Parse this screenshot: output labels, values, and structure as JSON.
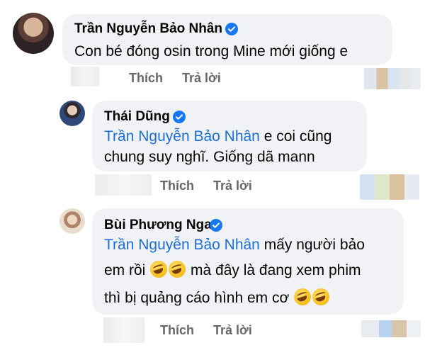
{
  "comments": [
    {
      "author": "Trần Nguyễn Bảo Nhân",
      "lines": [
        "Con bé đóng osin trong Mine mới giống e"
      ],
      "like_label": "Thích",
      "reply_label": "Trả lời",
      "avatar_colors": [
        "#3a2a2a",
        "#c9a089"
      ]
    },
    {
      "author": "Thái Dũng",
      "mention": "Trần Nguyễn Bảo Nhân",
      "line1_rest": " e coi cũng",
      "line2": "chung suy nghĩ. Giống dã mann",
      "like_label": "Thích",
      "reply_label": "Trả lời",
      "avatar_colors": [
        "#2b3a5a",
        "#d8c3b0"
      ]
    },
    {
      "author": "Bùi Phương Nga",
      "mention": "Trần Nguyễn Bảo Nhân",
      "line1_rest": " mấy người bảo",
      "line2_text": "em rồi ",
      "line2_after": " mà đây là đang xem phim",
      "line3_text": "thì bị quảng cáo hình em cơ ",
      "emoji_name": "rofl-emoji",
      "like_label": "Thích",
      "reply_label": "Trả lời",
      "avatar_colors": [
        "#c7a48a",
        "#f1e1d3"
      ]
    }
  ],
  "colors": {
    "bubble": "#f0f2f5",
    "mention": "#1d6ed8",
    "verified": "#1877f2",
    "action": "#65676b"
  },
  "icons": {
    "verified": "verified-badge-icon"
  }
}
